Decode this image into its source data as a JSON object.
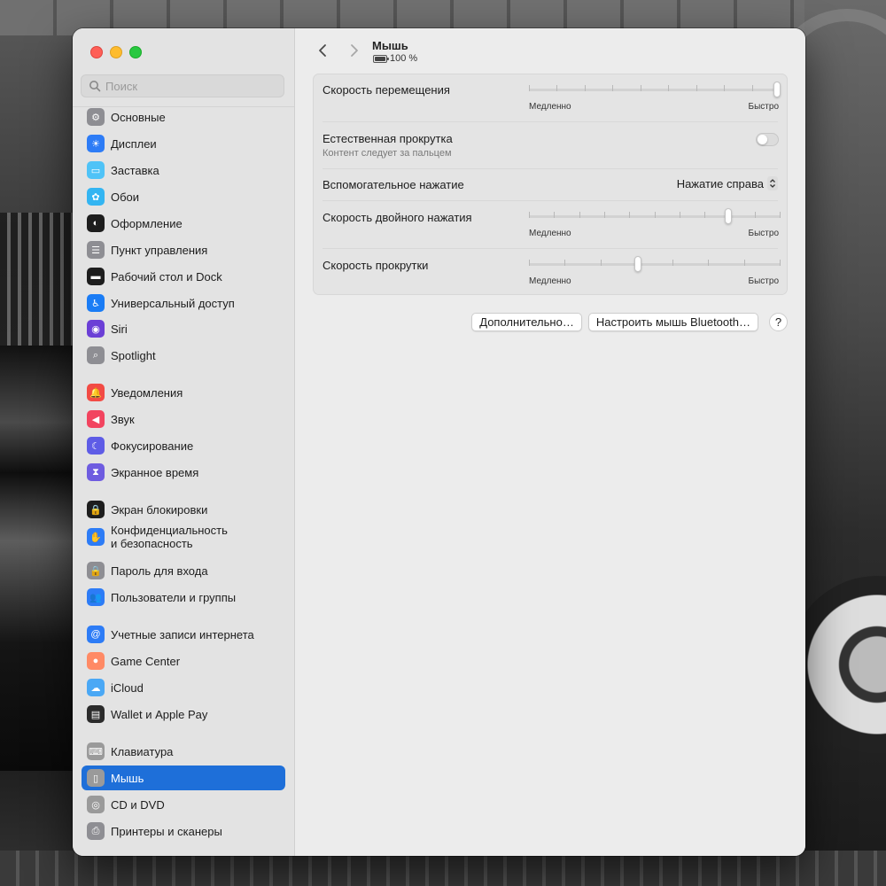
{
  "window": {
    "title": "Мышь",
    "battery": "100 %"
  },
  "search": {
    "placeholder": "Поиск"
  },
  "sidebar": {
    "items": [
      {
        "label": "Основные",
        "icon": "gear-icon",
        "color": "#8e8e93"
      },
      {
        "label": "Дисплеи",
        "icon": "sun-icon",
        "color": "#2d7cf6"
      },
      {
        "label": "Заставка",
        "icon": "screensaver-icon",
        "color": "#4fc3f7"
      },
      {
        "label": "Обои",
        "icon": "flower-icon",
        "color": "#33b5f2"
      },
      {
        "label": "Оформление",
        "icon": "appearance-icon",
        "color": "#1d1d1d"
      },
      {
        "label": "Пункт управления",
        "icon": "control-center-icon",
        "color": "#8e8e93"
      },
      {
        "label": "Рабочий стол и Dock",
        "icon": "dock-icon",
        "color": "#1d1d1d"
      },
      {
        "label": "Универсальный доступ",
        "icon": "accessibility-icon",
        "color": "#1a7cf5"
      },
      {
        "label": "Siri",
        "icon": "siri-icon",
        "color": "#6b3fd6"
      },
      {
        "label": "Spotlight",
        "icon": "magnifier-icon",
        "color": "#8e8e93"
      },
      {
        "label": "Уведомления",
        "icon": "bell-icon",
        "color": "#f24b44"
      },
      {
        "label": "Звук",
        "icon": "speaker-icon",
        "color": "#f2445f"
      },
      {
        "label": "Фокусирование",
        "icon": "moon-icon",
        "color": "#5e5ce6"
      },
      {
        "label": "Экранное время",
        "icon": "hourglass-icon",
        "color": "#6e5ce0"
      },
      {
        "label": "Экран блокировки",
        "icon": "lock-icon",
        "color": "#1d1d1d"
      },
      {
        "label1": "Конфиденциальность",
        "label2": "и безопасность",
        "icon": "hand-icon",
        "color": "#2d7cf6"
      },
      {
        "label": "Пароль для входа",
        "icon": "padlock-icon",
        "color": "#8e8e93"
      },
      {
        "label": "Пользователи и группы",
        "icon": "users-icon",
        "color": "#2d7cf6"
      },
      {
        "label": "Учетные записи интернета",
        "icon": "at-icon",
        "color": "#2d7cf6"
      },
      {
        "label": "Game Center",
        "icon": "game-center-icon",
        "color": "#ff8a65"
      },
      {
        "label": "iCloud",
        "icon": "cloud-icon",
        "color": "#4aa8f5"
      },
      {
        "label": "Wallet и Apple Pay",
        "icon": "wallet-icon",
        "color": "#2b2b2b"
      },
      {
        "label": "Клавиатура",
        "icon": "keyboard-icon",
        "color": "#9a9a9a"
      },
      {
        "label": "Мышь",
        "icon": "mouse-icon",
        "color": "#9a9a9a"
      },
      {
        "label": "CD и DVD",
        "icon": "disc-icon",
        "color": "#9a9a9a"
      },
      {
        "label": "Принтеры и сканеры",
        "icon": "printer-icon",
        "color": "#8e8e93"
      }
    ],
    "selected": "Мышь"
  },
  "settings": {
    "tracking_speed": {
      "label": "Скорость перемещения",
      "slow": "Медленно",
      "fast": "Быстро",
      "value": 1.0,
      "ticks": 10
    },
    "natural_scroll": {
      "label": "Естественная прокрутка",
      "sub": "Контент следует за пальцем",
      "on": false
    },
    "secondary_click": {
      "label": "Вспомогательное нажатие",
      "value": "Нажатие справа"
    },
    "double_click_speed": {
      "label": "Скорость двойного нажатия",
      "slow": "Медленно",
      "fast": "Быстро",
      "value": 0.8,
      "ticks": 11
    },
    "scroll_speed": {
      "label": "Скорость прокрутки",
      "slow": "Медленно",
      "fast": "Быстро",
      "value": 0.43,
      "ticks": 8
    }
  },
  "buttons": {
    "advanced": "Дополнительно…",
    "bluetooth": "Настроить мышь Bluetooth…",
    "help": "?"
  }
}
